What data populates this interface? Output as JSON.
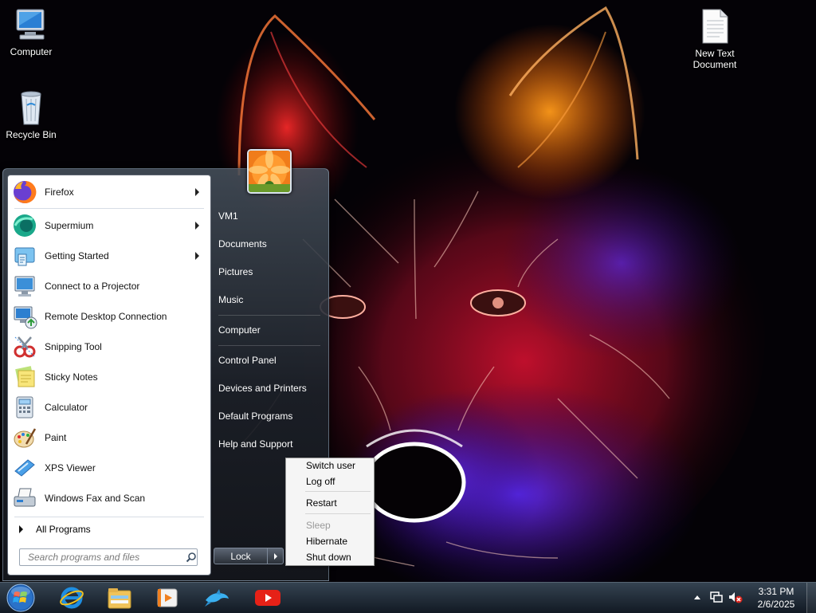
{
  "desktop": {
    "icons": [
      {
        "label": "Computer"
      },
      {
        "label": "Recycle Bin"
      },
      {
        "label": "New Text Document"
      }
    ]
  },
  "start_menu": {
    "programs": [
      {
        "label": "Firefox",
        "submenu": true
      },
      {
        "label": "Supermium",
        "submenu": true
      },
      {
        "label": "Getting Started",
        "submenu": true
      },
      {
        "label": "Connect to a Projector",
        "submenu": false
      },
      {
        "label": "Remote Desktop Connection",
        "submenu": false
      },
      {
        "label": "Snipping Tool",
        "submenu": false
      },
      {
        "label": "Sticky Notes",
        "submenu": false
      },
      {
        "label": "Calculator",
        "submenu": false
      },
      {
        "label": "Paint",
        "submenu": false
      },
      {
        "label": "XPS Viewer",
        "submenu": false
      },
      {
        "label": "Windows Fax and Scan",
        "submenu": false
      }
    ],
    "all_programs": "All Programs",
    "search": {
      "placeholder": "Search programs and files"
    },
    "right_links": [
      {
        "label": "VM1"
      },
      {
        "label": "Documents"
      },
      {
        "label": "Pictures"
      },
      {
        "label": "Music"
      },
      {
        "label": "Computer"
      },
      {
        "label": "Control Panel"
      },
      {
        "label": "Devices and Printers"
      },
      {
        "label": "Default Programs"
      },
      {
        "label": "Help and Support"
      }
    ],
    "lock_button": "Lock"
  },
  "power_menu": {
    "items": [
      {
        "label": "Switch user",
        "enabled": true
      },
      {
        "label": "Log off",
        "enabled": true
      },
      {
        "label": "Restart",
        "enabled": true
      },
      {
        "label": "Sleep",
        "enabled": false
      },
      {
        "label": "Hibernate",
        "enabled": true
      },
      {
        "label": "Shut down",
        "enabled": true
      }
    ]
  },
  "taskbar": {
    "pinned": [
      "start-orb-icon",
      "internet-explorer-icon",
      "file-explorer-icon",
      "media-player-icon",
      "dolphin-icon",
      "youtube-icon"
    ],
    "clock": {
      "time": "3:31 PM",
      "date": "2/6/2025"
    },
    "tray": [
      "show-hidden-icons",
      "network-icon",
      "volume-muted-icon"
    ]
  }
}
